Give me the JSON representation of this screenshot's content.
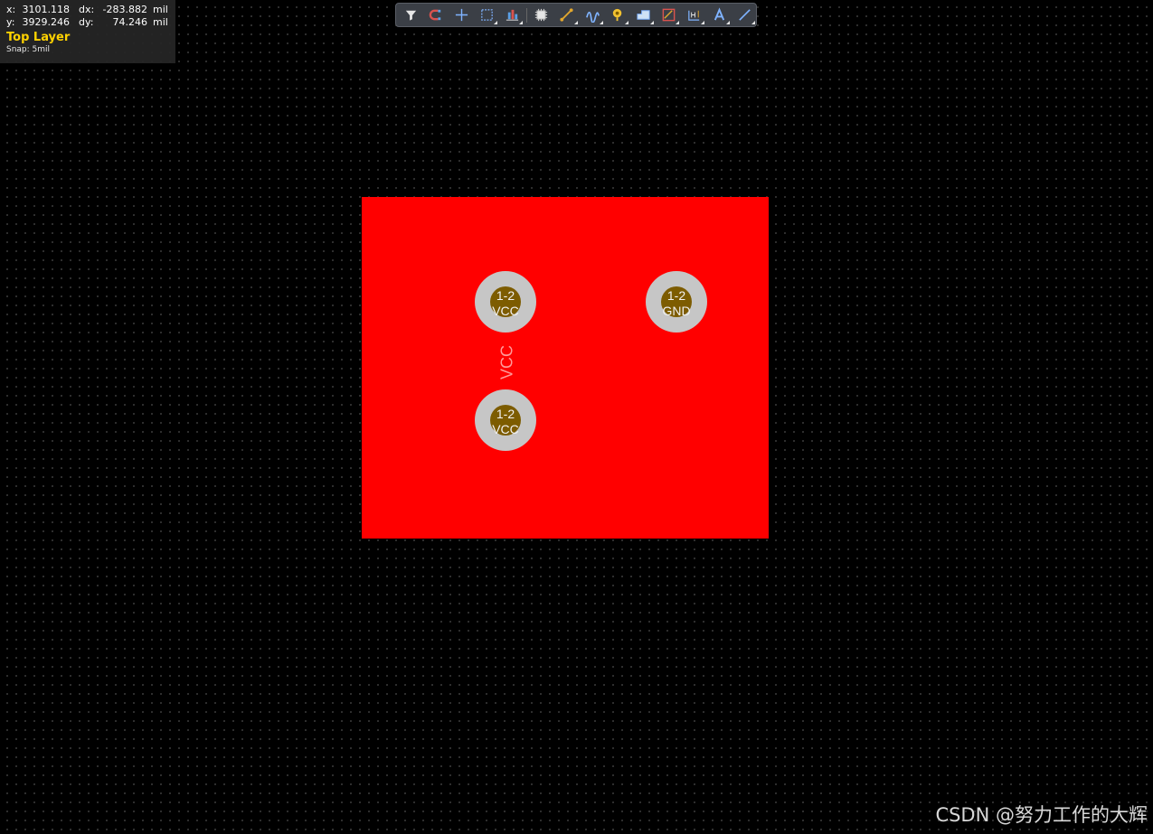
{
  "hud": {
    "x_label": "x:",
    "x_value": "3101.118",
    "dx_label": "dx:",
    "dx_value": "-283.882",
    "x_unit": "mil",
    "y_label": "y:",
    "y_value": "3929.246",
    "dy_label": "dy:",
    "dy_value": "74.246",
    "y_unit": "mil",
    "layer": "Top Layer",
    "snap": "Snap: 5mil"
  },
  "toolbar": {
    "tools": [
      {
        "name": "filter-icon"
      },
      {
        "name": "snap-magnet-icon"
      },
      {
        "name": "crosshair-icon"
      },
      {
        "name": "select-box-icon",
        "menu": true
      },
      {
        "name": "align-icon",
        "menu": true
      },
      {
        "name": "component-icon"
      },
      {
        "name": "route-track-icon",
        "menu": true
      },
      {
        "name": "diff-pair-icon",
        "menu": true
      },
      {
        "name": "via-icon",
        "menu": true
      },
      {
        "name": "polygon-pour-icon",
        "menu": true
      },
      {
        "name": "keepout-icon",
        "menu": true
      },
      {
        "name": "dimension-icon",
        "menu": true
      },
      {
        "name": "text-icon",
        "menu": true
      },
      {
        "name": "line-icon",
        "menu": true
      }
    ]
  },
  "colors": {
    "board": "#ff0000",
    "pad_ring": "#c6c6c6",
    "pad_hole": "#7d5c00",
    "layer_label": "#ffd200"
  },
  "pads": [
    {
      "number": "1-2",
      "net": "VCC"
    },
    {
      "number": "1-2",
      "net": "GND"
    },
    {
      "number": "1-2",
      "net": "VCC"
    }
  ],
  "net_label": "VCC",
  "watermark": "CSDN @努力工作的大辉"
}
